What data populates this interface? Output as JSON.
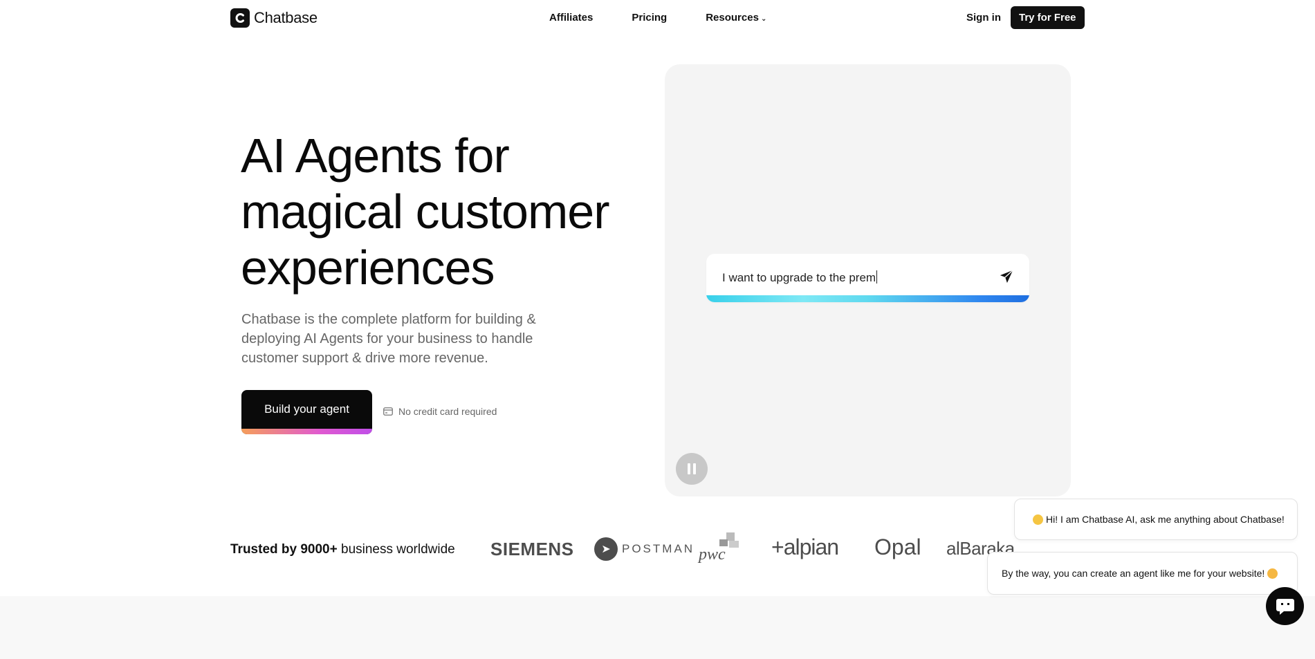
{
  "header": {
    "logo_text": "Chatbase",
    "nav": [
      {
        "label": "Affiliates"
      },
      {
        "label": "Pricing"
      },
      {
        "label": "Resources"
      }
    ],
    "sign_in": "Sign in",
    "cta": "Try for Free"
  },
  "hero": {
    "title_line1": "AI Agents for",
    "title_line2": "magical customer",
    "title_line3": "experiences",
    "subtitle": "Chatbase is the complete platform for building & deploying AI Agents for your business to handle customer support & drive more revenue.",
    "build_button": "Build your agent",
    "no_card_note": "No credit card required"
  },
  "demo": {
    "input_text": "I want to upgrade to the prem",
    "send_icon": "send-icon",
    "pause_icon": "pause-icon"
  },
  "trusted": {
    "bold": "Trusted by 9000+",
    "rest": " business worldwide",
    "logos": {
      "siemens": "SIEMENS",
      "postman": "POSTMAN",
      "pwc": "pwc",
      "alpian": "+alpian",
      "opal": "Opal",
      "albaraka": "alBaraka"
    }
  },
  "chat_widget": {
    "message1": "Hi! I am Chatbase AI, ask me anything about Chatbase!",
    "message2": "By the way, you can create an agent like me for your website!"
  },
  "colors": {
    "primary": "#0a0a0a",
    "panel_bg": "#f4f4f4",
    "muted_text": "#666666"
  }
}
